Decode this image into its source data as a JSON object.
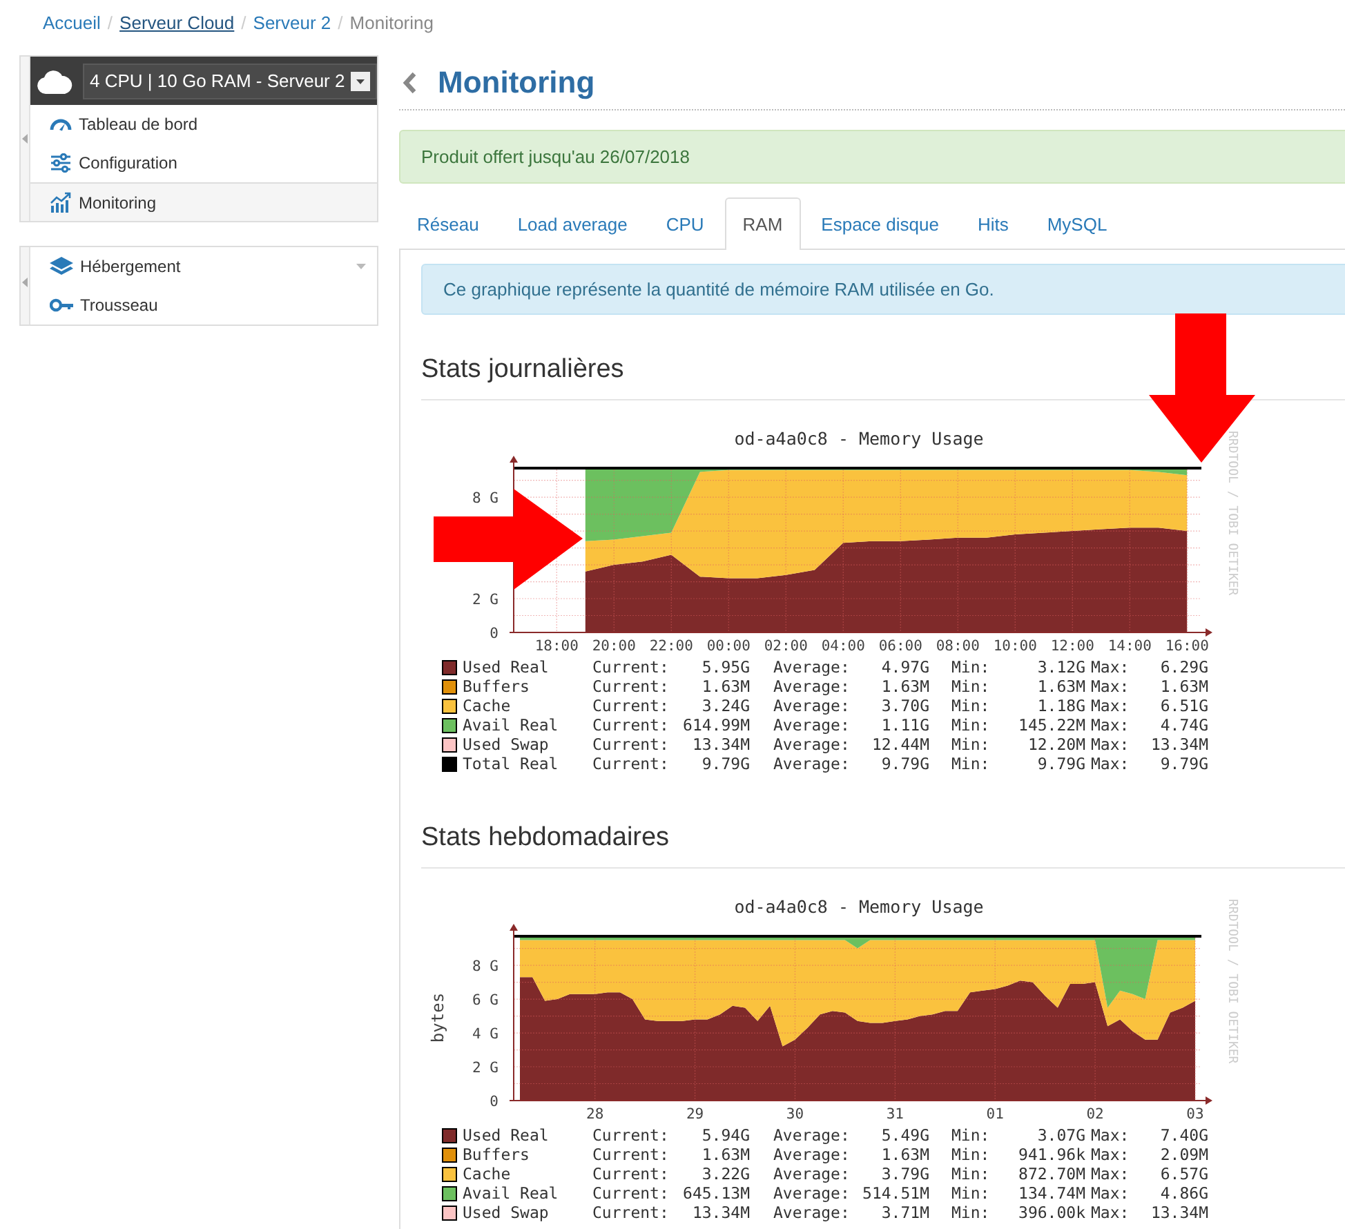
{
  "breadcrumb": [
    {
      "label": "Accueil",
      "kind": "link"
    },
    {
      "sep": "/",
      "label": "Serveur Cloud",
      "kind": "underlined"
    },
    {
      "sep": "/",
      "label": "Serveur 2",
      "kind": "link"
    },
    {
      "sep": "/",
      "label": "Monitoring",
      "kind": "current"
    }
  ],
  "sidebar": {
    "server_select": "4 CPU | 10 Go RAM - Serveur 2",
    "groups": [
      {
        "items": [
          {
            "label": "Tableau de bord",
            "selected": false,
            "expandable": false
          },
          {
            "label": "Configuration",
            "selected": false,
            "expandable": false
          },
          {
            "label": "Monitoring",
            "selected": true,
            "expandable": false
          }
        ]
      },
      {
        "items": [
          {
            "label": "Hébergement",
            "selected": false,
            "expandable": true
          },
          {
            "label": "Trousseau",
            "selected": false,
            "expandable": false
          }
        ]
      }
    ]
  },
  "page_title": "Monitoring",
  "notice": "Produit offert jusqu'au 26/07/2018",
  "tabs": [
    {
      "label": "Réseau",
      "selected": false
    },
    {
      "label": "Load average",
      "selected": false
    },
    {
      "label": "CPU",
      "selected": false
    },
    {
      "label": "RAM",
      "selected": true
    },
    {
      "label": "Espace disque",
      "selected": false
    },
    {
      "label": "Hits",
      "selected": false
    },
    {
      "label": "MySQL",
      "selected": false
    }
  ],
  "info": "Ce graphique représente la quantité de mémoire RAM utilisée en Go.",
  "sections": [
    {
      "heading": "Stats journalières",
      "side_text": "RRDTOOL / TOBI OETIKER",
      "arrows": true,
      "chart_data": {
        "type": "area",
        "stacked": true,
        "grid": true,
        "title": "od-a4a0c8 - Memory Usage",
        "ylim": [
          0,
          9.8
        ],
        "categories": [
          null,
          "18:00",
          null,
          "20:00",
          null,
          "22:00",
          null,
          "00:00",
          null,
          "02:00",
          null,
          "04:00",
          null,
          "06:00",
          null,
          "08:00",
          null,
          "10:00",
          null,
          "12:00",
          null,
          "14:00",
          null,
          "16:00"
        ],
        "yticks": [
          {
            "value": 0,
            "label": "0"
          },
          {
            "value": 2,
            "label": "2 G"
          },
          {
            "value": 8,
            "label": "8 G"
          }
        ],
        "series": [
          {
            "color": "#7f2a2a",
            "values": [
              null,
              null,
              3.6,
              4.0,
              4.2,
              4.6,
              3.3,
              3.2,
              3.2,
              3.4,
              3.7,
              5.3,
              5.4,
              5.4,
              5.5,
              5.6,
              5.6,
              5.8,
              5.9,
              6.0,
              6.1,
              6.2,
              6.2,
              6.0
            ]
          },
          {
            "color": "#fac23e",
            "values": [
              null,
              null,
              1.8,
              1.5,
              1.5,
              1.3,
              6.2,
              6.4,
              6.4,
              6.2,
              5.9,
              4.3,
              4.2,
              4.2,
              4.1,
              4.0,
              4.0,
              3.8,
              3.7,
              3.6,
              3.5,
              3.4,
              3.3,
              3.3
            ]
          },
          {
            "color": "#6cc05f",
            "values": [
              null,
              null,
              4.4,
              4.3,
              4.1,
              3.9,
              0.3,
              0.2,
              0.2,
              0.2,
              0.2,
              0.2,
              0.2,
              0.2,
              0.2,
              0.2,
              0.2,
              0.2,
              0.2,
              0.2,
              0.2,
              0.2,
              0.3,
              0.5
            ]
          }
        ]
      },
      "legend": [
        {
          "name": "Used Real",
          "color": "#7f2a2a",
          "stats": [
            [
              "Current:",
              "5.95G"
            ],
            [
              "Average:",
              "4.97G"
            ],
            [
              "Min:",
              "3.12G"
            ],
            [
              "Max:",
              "6.29G"
            ]
          ]
        },
        {
          "name": "Buffers",
          "color": "#e0900a",
          "stats": [
            [
              "Current:",
              "1.63M"
            ],
            [
              "Average:",
              "1.63M"
            ],
            [
              "Min:",
              "1.63M"
            ],
            [
              "Max:",
              "1.63M"
            ]
          ]
        },
        {
          "name": "Cache",
          "color": "#fac23e",
          "stats": [
            [
              "Current:",
              "3.24G"
            ],
            [
              "Average:",
              "3.70G"
            ],
            [
              "Min:",
              "1.18G"
            ],
            [
              "Max:",
              "6.51G"
            ]
          ]
        },
        {
          "name": "Avail Real",
          "color": "#6cc05f",
          "stats": [
            [
              "Current:",
              "614.99M"
            ],
            [
              "Average:",
              "1.11G"
            ],
            [
              "Min:",
              "145.22M"
            ],
            [
              "Max:",
              "4.74G"
            ]
          ]
        },
        {
          "name": "Used Swap",
          "color": "#fcc4c4",
          "stats": [
            [
              "Current:",
              "13.34M"
            ],
            [
              "Average:",
              "12.44M"
            ],
            [
              "Min:",
              "12.20M"
            ],
            [
              "Max:",
              "13.34M"
            ]
          ]
        },
        {
          "name": "Total Real",
          "color": "#000000",
          "stats": [
            [
              "Current:",
              "9.79G"
            ],
            [
              "Average:",
              "9.79G"
            ],
            [
              "Min:",
              "9.79G"
            ],
            [
              "Max:",
              "9.79G"
            ]
          ]
        }
      ]
    },
    {
      "heading": "Stats hebdomadaires",
      "side_text": "RRDTOOL / TOBI OETIKER",
      "arrows": false,
      "chart_data": {
        "type": "area",
        "stacked": true,
        "grid": true,
        "title": "od-a4a0c8 - Memory Usage",
        "ylabel": "bytes",
        "ylim": [
          0,
          9.8
        ],
        "categories": [
          null,
          null,
          null,
          null,
          null,
          null,
          "28",
          null,
          null,
          null,
          null,
          null,
          null,
          null,
          "29",
          null,
          null,
          null,
          null,
          null,
          null,
          null,
          "30",
          null,
          null,
          null,
          null,
          null,
          null,
          null,
          "31",
          null,
          null,
          null,
          null,
          null,
          null,
          null,
          "01",
          null,
          null,
          null,
          null,
          null,
          null,
          null,
          "02",
          null,
          null,
          null,
          null,
          null,
          null,
          null,
          "03"
        ],
        "yticks": [
          {
            "value": 0,
            "label": "0"
          },
          {
            "value": 2,
            "label": "2 G"
          },
          {
            "value": 4,
            "label": "4 G"
          },
          {
            "value": 6,
            "label": "6 G"
          },
          {
            "value": 8,
            "label": "8 G"
          }
        ],
        "series": [
          {
            "color": "#7f2a2a",
            "values": [
              7.3,
              7.3,
              5.9,
              6.0,
              6.3,
              6.3,
              6.3,
              6.4,
              6.4,
              6.0,
              4.8,
              4.7,
              4.7,
              4.7,
              4.8,
              4.8,
              5.1,
              5.6,
              5.5,
              4.7,
              5.6,
              3.2,
              3.6,
              4.3,
              5.1,
              5.3,
              5.2,
              4.7,
              4.6,
              4.6,
              4.7,
              4.8,
              5.0,
              5.1,
              5.3,
              5.3,
              6.4,
              6.5,
              6.6,
              6.8,
              7.1,
              7.0,
              6.2,
              5.5,
              6.9,
              6.9,
              7.0,
              4.4,
              4.8,
              4.1,
              3.6,
              3.6,
              5.2,
              5.5,
              5.9
            ]
          },
          {
            "color": "#fac23e",
            "values": [
              2.2,
              2.2,
              3.6,
              3.5,
              3.2,
              3.2,
              3.2,
              3.1,
              3.1,
              3.5,
              4.7,
              4.8,
              4.8,
              4.8,
              4.7,
              4.7,
              4.4,
              3.9,
              4.0,
              4.8,
              3.9,
              6.3,
              5.9,
              5.2,
              4.4,
              4.2,
              4.3,
              4.3,
              4.9,
              4.9,
              4.8,
              4.7,
              4.5,
              4.4,
              4.2,
              4.2,
              3.1,
              3.0,
              2.9,
              2.7,
              2.4,
              2.5,
              3.3,
              4.0,
              2.6,
              2.6,
              2.5,
              1.1,
              1.7,
              2.2,
              2.4,
              5.9,
              4.3,
              4.0,
              3.6
            ]
          },
          {
            "color": "#6cc05f",
            "values": [
              0.3,
              0.3,
              0.3,
              0.3,
              0.3,
              0.3,
              0.3,
              0.3,
              0.3,
              0.3,
              0.3,
              0.3,
              0.3,
              0.3,
              0.3,
              0.3,
              0.3,
              0.3,
              0.3,
              0.3,
              0.3,
              0.3,
              0.3,
              0.3,
              0.3,
              0.3,
              0.3,
              0.8,
              0.3,
              0.3,
              0.3,
              0.3,
              0.3,
              0.3,
              0.3,
              0.3,
              0.3,
              0.3,
              0.3,
              0.3,
              0.3,
              0.3,
              0.3,
              0.3,
              0.3,
              0.3,
              0.3,
              4.3,
              3.3,
              3.5,
              3.8,
              0.3,
              0.3,
              0.3,
              0.3
            ]
          }
        ]
      },
      "legend": [
        {
          "name": "Used Real",
          "color": "#7f2a2a",
          "stats": [
            [
              "Current:",
              "5.94G"
            ],
            [
              "Average:",
              "5.49G"
            ],
            [
              "Min:",
              "3.07G"
            ],
            [
              "Max:",
              "7.40G"
            ]
          ]
        },
        {
          "name": "Buffers",
          "color": "#e0900a",
          "stats": [
            [
              "Current:",
              "1.63M"
            ],
            [
              "Average:",
              "1.63M"
            ],
            [
              "Min:",
              "941.96k"
            ],
            [
              "Max:",
              "2.09M"
            ]
          ]
        },
        {
          "name": "Cache",
          "color": "#fac23e",
          "stats": [
            [
              "Current:",
              "3.22G"
            ],
            [
              "Average:",
              "3.79G"
            ],
            [
              "Min:",
              "872.70M"
            ],
            [
              "Max:",
              "6.57G"
            ]
          ]
        },
        {
          "name": "Avail Real",
          "color": "#6cc05f",
          "stats": [
            [
              "Current:",
              "645.13M"
            ],
            [
              "Average:",
              "514.51M"
            ],
            [
              "Min:",
              "134.74M"
            ],
            [
              "Max:",
              "4.86G"
            ]
          ]
        },
        {
          "name": "Used Swap",
          "color": "#fcc4c4",
          "stats": [
            [
              "Current:",
              "13.34M"
            ],
            [
              "Average:",
              "3.71M"
            ],
            [
              "Min:",
              "396.00k"
            ],
            [
              "Max:",
              "13.34M"
            ]
          ]
        }
      ]
    }
  ]
}
